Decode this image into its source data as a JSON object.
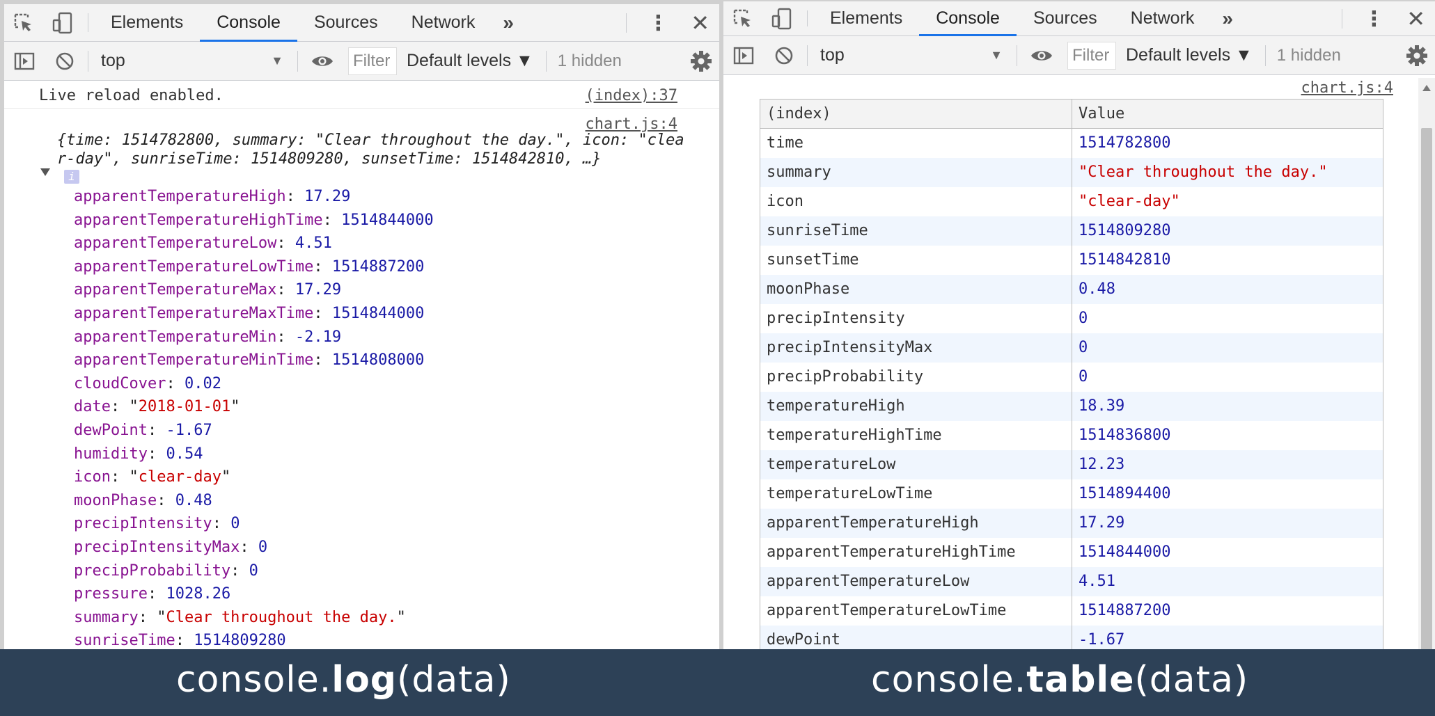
{
  "left": {
    "tabs": [
      "Elements",
      "Console",
      "Sources",
      "Network"
    ],
    "active_tab": "Console",
    "more_tabs": "»",
    "context": "top",
    "filter_placeholder": "Filter",
    "levels": "Default levels ▼",
    "hidden": "1 hidden",
    "log_message": "Live reload enabled.",
    "log_source": "(index):37",
    "object_source": "chart.js:4",
    "preview": "{time: 1514782800, summary: \"Clear throughout the day.\", icon: \"clear-day\", sunriseTime: 1514809280, sunsetTime: 1514842810, …}",
    "info": "i",
    "properties": [
      {
        "key": "apparentTemperatureHigh",
        "value": "17.29",
        "type": "num"
      },
      {
        "key": "apparentTemperatureHighTime",
        "value": "1514844000",
        "type": "num"
      },
      {
        "key": "apparentTemperatureLow",
        "value": "4.51",
        "type": "num"
      },
      {
        "key": "apparentTemperatureLowTime",
        "value": "1514887200",
        "type": "num"
      },
      {
        "key": "apparentTemperatureMax",
        "value": "17.29",
        "type": "num"
      },
      {
        "key": "apparentTemperatureMaxTime",
        "value": "1514844000",
        "type": "num"
      },
      {
        "key": "apparentTemperatureMin",
        "value": "-2.19",
        "type": "num"
      },
      {
        "key": "apparentTemperatureMinTime",
        "value": "1514808000",
        "type": "num"
      },
      {
        "key": "cloudCover",
        "value": "0.02",
        "type": "num"
      },
      {
        "key": "date",
        "value": "2018-01-01",
        "type": "str"
      },
      {
        "key": "dewPoint",
        "value": "-1.67",
        "type": "num"
      },
      {
        "key": "humidity",
        "value": "0.54",
        "type": "num"
      },
      {
        "key": "icon",
        "value": "clear-day",
        "type": "str"
      },
      {
        "key": "moonPhase",
        "value": "0.48",
        "type": "num"
      },
      {
        "key": "precipIntensity",
        "value": "0",
        "type": "num"
      },
      {
        "key": "precipIntensityMax",
        "value": "0",
        "type": "num"
      },
      {
        "key": "precipProbability",
        "value": "0",
        "type": "num"
      },
      {
        "key": "pressure",
        "value": "1028.26",
        "type": "num"
      },
      {
        "key": "summary",
        "value": "Clear throughout the day.",
        "type": "str"
      },
      {
        "key": "sunriseTime",
        "value": "1514809280",
        "type": "num"
      }
    ]
  },
  "right": {
    "tabs": [
      "Elements",
      "Console",
      "Sources",
      "Network"
    ],
    "active_tab": "Console",
    "more_tabs": "»",
    "context": "top",
    "filter_placeholder": "Filter",
    "levels": "Default levels ▼",
    "hidden": "1 hidden",
    "table_source": "chart.js:4",
    "headers": [
      "(index)",
      "Value"
    ],
    "rows": [
      {
        "key": "time",
        "value": "1514782800",
        "type": "num"
      },
      {
        "key": "summary",
        "value": "\"Clear throughout the day.\"",
        "type": "str"
      },
      {
        "key": "icon",
        "value": "\"clear-day\"",
        "type": "str"
      },
      {
        "key": "sunriseTime",
        "value": "1514809280",
        "type": "num"
      },
      {
        "key": "sunsetTime",
        "value": "1514842810",
        "type": "num"
      },
      {
        "key": "moonPhase",
        "value": "0.48",
        "type": "num"
      },
      {
        "key": "precipIntensity",
        "value": "0",
        "type": "num"
      },
      {
        "key": "precipIntensityMax",
        "value": "0",
        "type": "num"
      },
      {
        "key": "precipProbability",
        "value": "0",
        "type": "num"
      },
      {
        "key": "temperatureHigh",
        "value": "18.39",
        "type": "num"
      },
      {
        "key": "temperatureHighTime",
        "value": "1514836800",
        "type": "num"
      },
      {
        "key": "temperatureLow",
        "value": "12.23",
        "type": "num"
      },
      {
        "key": "temperatureLowTime",
        "value": "1514894400",
        "type": "num"
      },
      {
        "key": "apparentTemperatureHigh",
        "value": "17.29",
        "type": "num"
      },
      {
        "key": "apparentTemperatureHighTime",
        "value": "1514844000",
        "type": "num"
      },
      {
        "key": "apparentTemperatureLow",
        "value": "4.51",
        "type": "num"
      },
      {
        "key": "apparentTemperatureLowTime",
        "value": "1514887200",
        "type": "num"
      },
      {
        "key": "dewPoint",
        "value": "-1.67",
        "type": "num"
      }
    ]
  },
  "captions": {
    "left": {
      "prefix": "console.",
      "method": "log",
      "args": "(data)"
    },
    "right": {
      "prefix": "console.",
      "method": "table",
      "args": "(data)"
    }
  },
  "colors": {
    "accent": "#1a73e8",
    "key": "#881391",
    "number": "#1a1aa6",
    "string": "#c80000",
    "banner": "#2d4157"
  }
}
